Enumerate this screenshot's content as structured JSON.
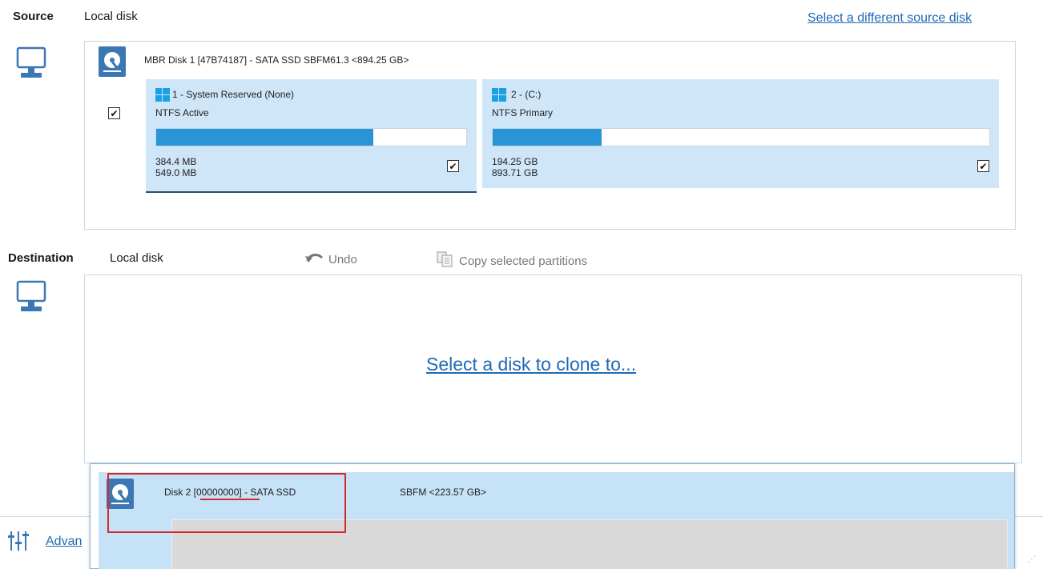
{
  "source": {
    "label": "Source",
    "type": "Local disk",
    "change_link": "Select a different source disk",
    "disk": {
      "title": "MBR Disk 1 [47B74187] - SATA SSD SBFM61.3  <894.25 GB>",
      "checked": true,
      "partitions": [
        {
          "name": "1 - System Reserved (None)",
          "fs": "NTFS Active",
          "used": "384.4 MB",
          "total": "549.0 MB",
          "used_fraction": 0.7,
          "checked": true
        },
        {
          "name": "2 - (C:)",
          "fs": "NTFS Primary",
          "used": "194.25 GB",
          "total": "893.71 GB",
          "used_fraction": 0.22,
          "checked": true
        }
      ]
    }
  },
  "destination": {
    "label": "Destination",
    "type": "Local disk",
    "undo_label": "Undo",
    "copy_label": "Copy selected partitions",
    "select_link": "Select a disk to clone to...",
    "dropdown_disk": {
      "title": "Disk 2 [00000000] - SATA SSD",
      "model": "SBFM  <223.57 GB>"
    }
  },
  "footer": {
    "advanced_label": "Advan"
  },
  "icons": {
    "monitor": "monitor-icon",
    "disk": "disk-icon",
    "undo": "undo-icon",
    "copy": "copy-icon",
    "settings": "sliders-icon",
    "windows": "windows-logo-icon"
  },
  "colors": {
    "accent": "#1f6ab5",
    "partition_bg": "#cfe6f9",
    "usage_bar": "#2a95d6",
    "highlight_box": "#d42a2a",
    "dropdown_bg": "#c5e2f7"
  }
}
